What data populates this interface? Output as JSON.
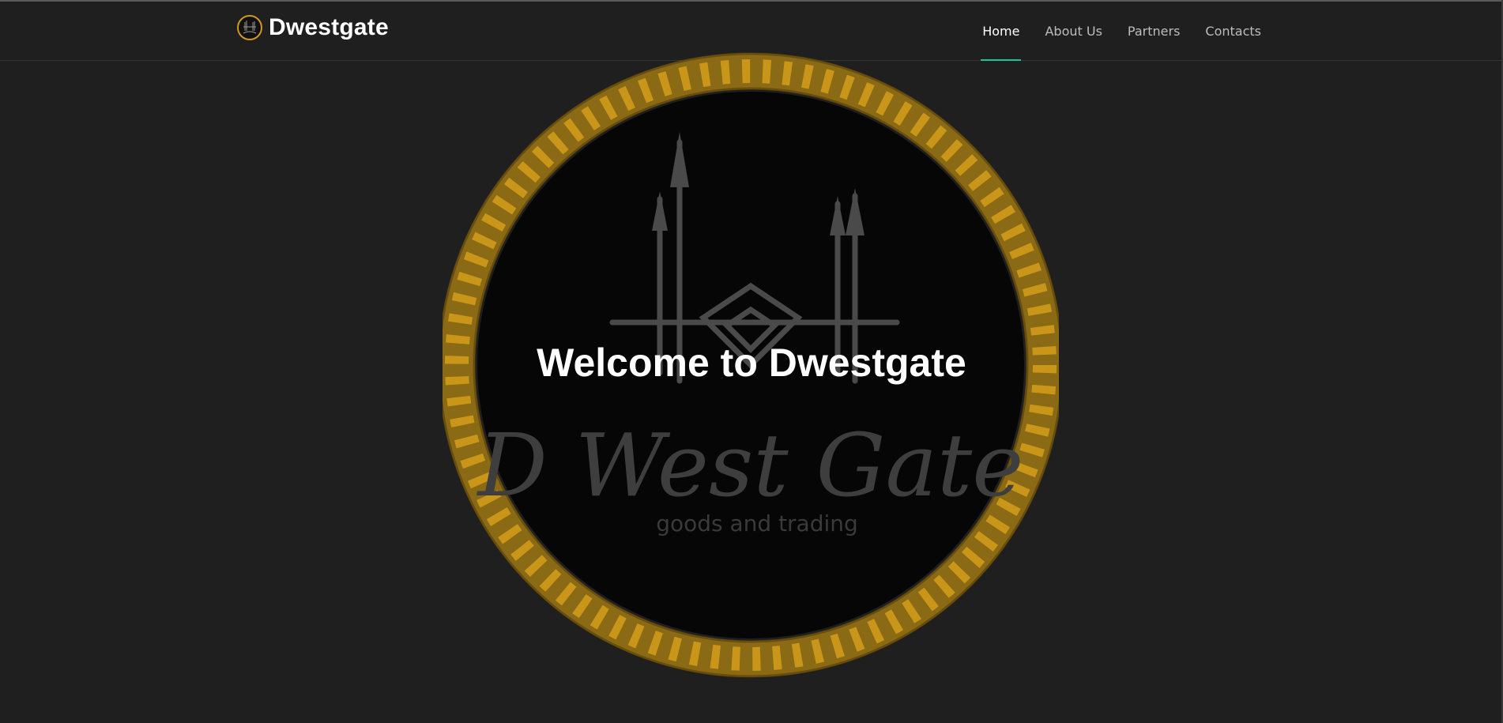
{
  "header": {
    "brand_name": "Dwestgate",
    "logo_icon": "dwestgate-logo-icon"
  },
  "nav": {
    "items": [
      {
        "label": "Home",
        "active": true
      },
      {
        "label": "About Us",
        "active": false
      },
      {
        "label": "Partners",
        "active": false
      },
      {
        "label": "Contacts",
        "active": false
      }
    ]
  },
  "hero": {
    "title": "Welcome to Dwestgate",
    "emblem_text": "D West Gate",
    "emblem_tagline": "goods and trading"
  },
  "colors": {
    "background": "#1f1f1f",
    "accent": "#18c59a",
    "rope": "#b8860b"
  }
}
